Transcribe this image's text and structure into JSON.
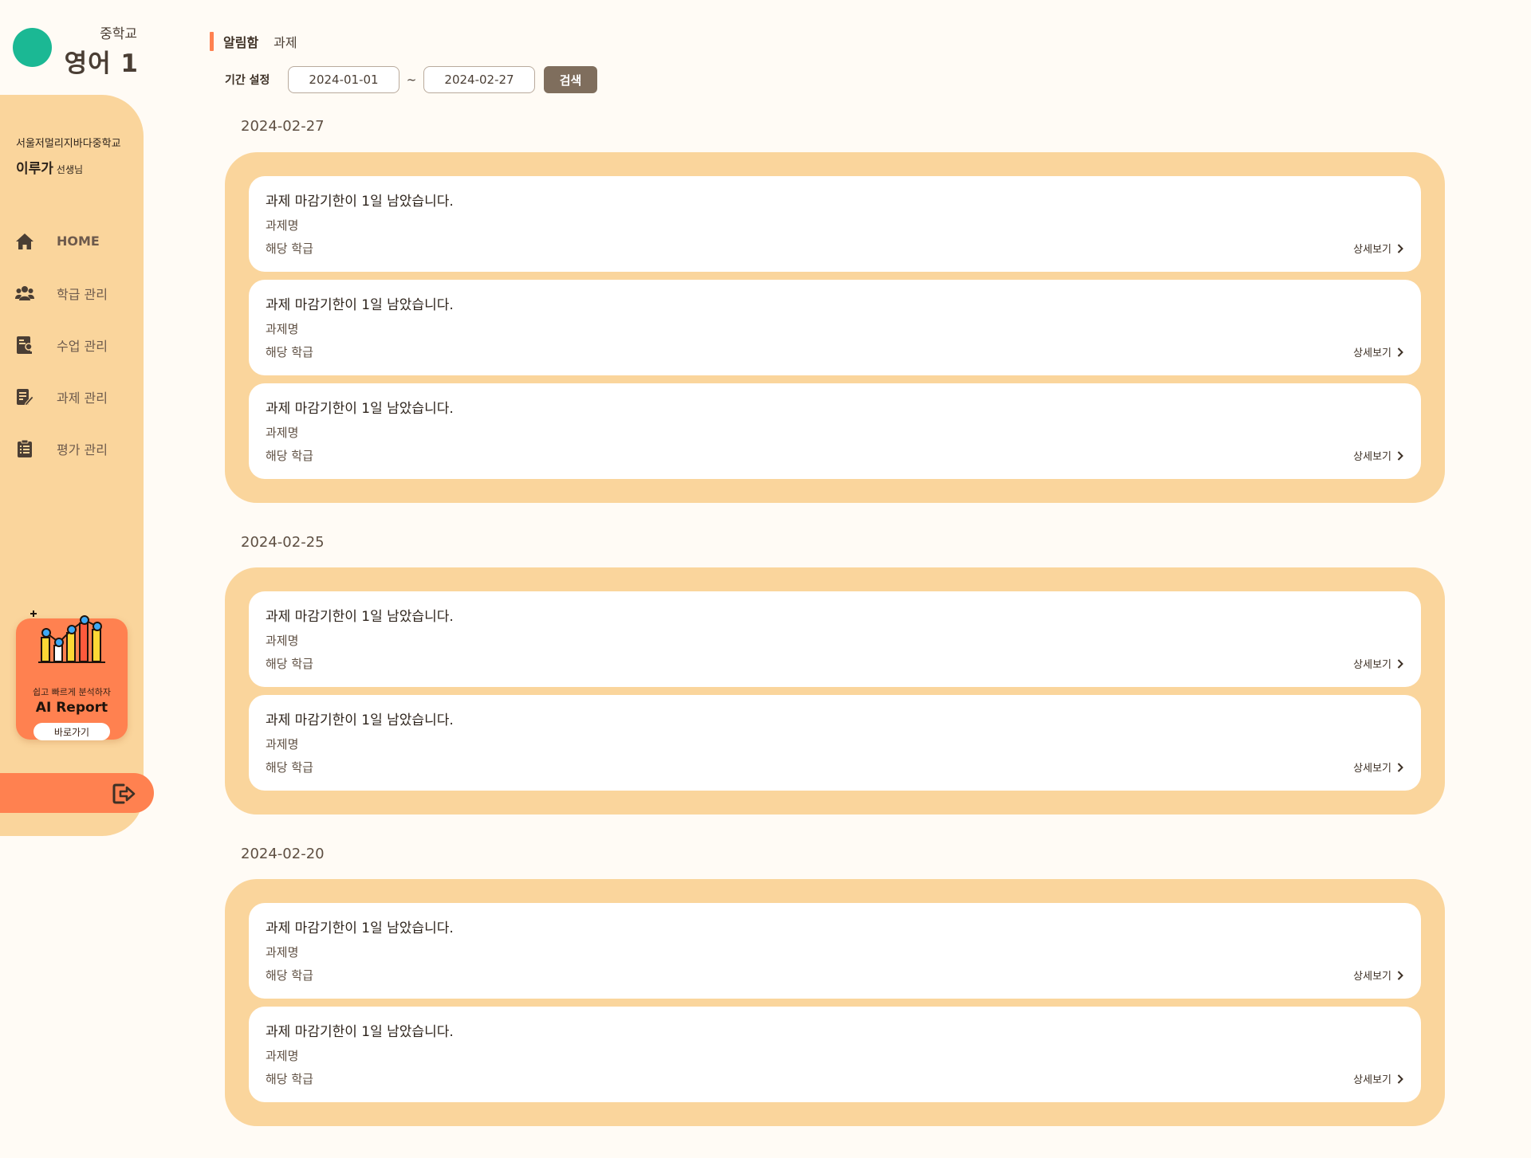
{
  "brand": {
    "level": "중학교",
    "subject": "영어 1",
    "accent": "#1bb894"
  },
  "user": {
    "school": "서울저멀리지바다중학교",
    "name": "이루가",
    "role": "선생님"
  },
  "nav": [
    {
      "label": "HOME",
      "icon": "home-icon"
    },
    {
      "label": "학급 관리",
      "icon": "users-icon"
    },
    {
      "label": "수업 관리",
      "icon": "lesson-icon"
    },
    {
      "label": "과제 관리",
      "icon": "assignment-icon"
    },
    {
      "label": "평가 관리",
      "icon": "clipboard-icon"
    }
  ],
  "ai_report": {
    "tagline": "쉽고 빠르게 분석하자",
    "title": "AI Report",
    "button": "바로가기"
  },
  "breadcrumb": {
    "section": "알림함",
    "current": "과제"
  },
  "filter": {
    "label": "기간 설정",
    "start": "2024-01-01",
    "separator": "~",
    "end": "2024-02-27",
    "search": "검색"
  },
  "notices": [
    {
      "date": "2024-02-27",
      "items": [
        {
          "title": "과제 마감기한이 1일 남았습니다.",
          "assignment": "과제명",
          "class": "해당 학급",
          "more": "상세보기"
        },
        {
          "title": "과제 마감기한이 1일 남았습니다.",
          "assignment": "과제명",
          "class": "해당 학급",
          "more": "상세보기"
        },
        {
          "title": "과제 마감기한이 1일 남았습니다.",
          "assignment": "과제명",
          "class": "해당 학급",
          "more": "상세보기"
        }
      ]
    },
    {
      "date": "2024-02-25",
      "items": [
        {
          "title": "과제 마감기한이 1일 남았습니다.",
          "assignment": "과제명",
          "class": "해당 학급",
          "more": "상세보기"
        },
        {
          "title": "과제 마감기한이 1일 남았습니다.",
          "assignment": "과제명",
          "class": "해당 학급",
          "more": "상세보기"
        }
      ]
    },
    {
      "date": "2024-02-20",
      "items": [
        {
          "title": "과제 마감기한이 1일 남았습니다.",
          "assignment": "과제명",
          "class": "해당 학급",
          "more": "상세보기"
        },
        {
          "title": "과제 마감기한이 1일 남았습니다.",
          "assignment": "과제명",
          "class": "해당 학급",
          "more": "상세보기"
        }
      ]
    }
  ],
  "colors": {
    "sidebar": "#fad59c",
    "accent": "#ff8150",
    "button": "#7f6e5d",
    "background": "#fffbf5"
  }
}
